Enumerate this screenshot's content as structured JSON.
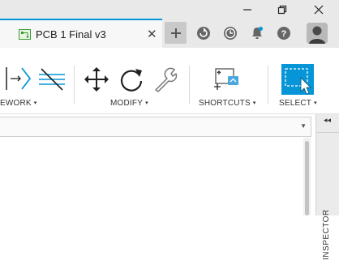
{
  "window": {
    "controls": [
      "minimize-icon",
      "restore-icon",
      "close-icon"
    ]
  },
  "tab": {
    "title": "PCB 1 Final v3",
    "close_glyph": "✕",
    "icon": "pcb-file-icon"
  },
  "header_icons": [
    "new-tab-plus-icon",
    "extensions-icon",
    "job-status-icon",
    "notifications-icon",
    "help-icon",
    "user-avatar"
  ],
  "toolbar": {
    "groups": [
      {
        "label": "EWORK",
        "caret": "▾"
      },
      {
        "label": "MODIFY",
        "caret": "▾"
      },
      {
        "label": "SHORTCUTS",
        "caret": "▾"
      },
      {
        "label": "SELECT",
        "caret": "▾"
      }
    ],
    "accent_color": "#0696d7"
  },
  "dropdown": {
    "arrow": "▼",
    "value": ""
  },
  "inspector": {
    "label": "INSPECTOR",
    "collapse_glyph": "◂◂"
  }
}
